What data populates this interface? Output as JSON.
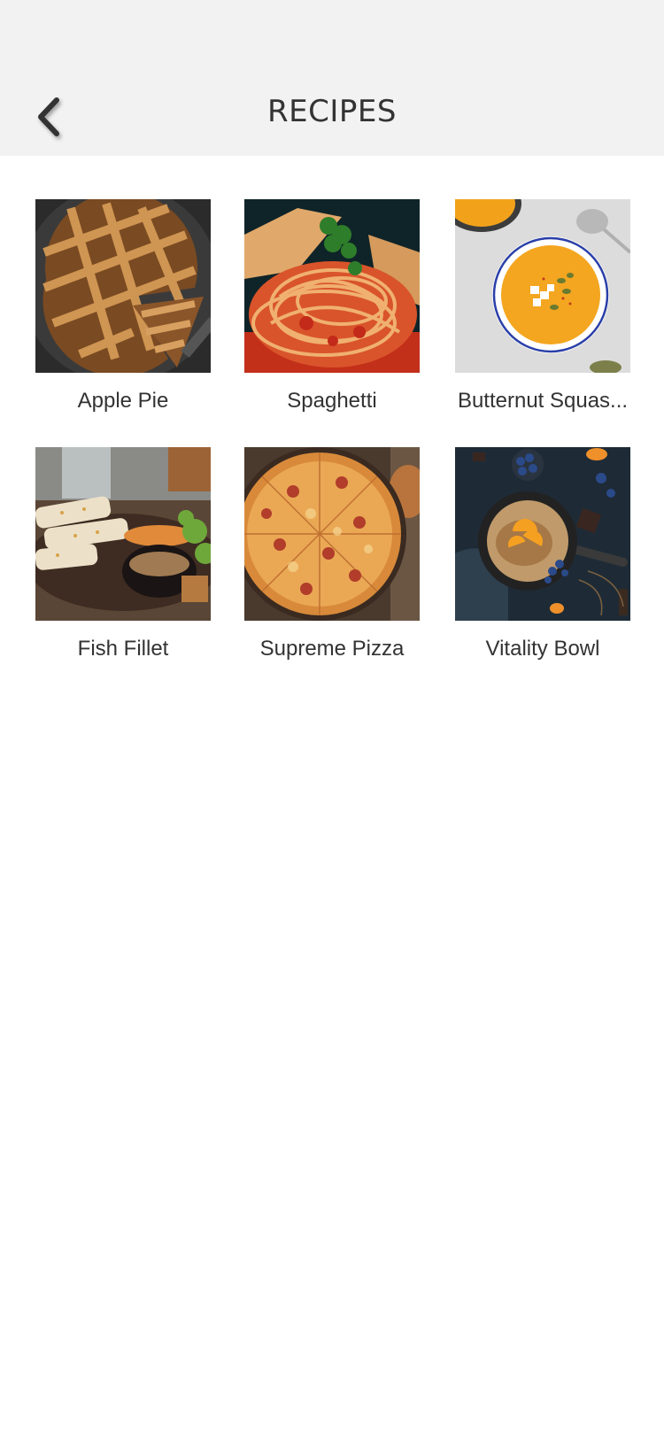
{
  "header": {
    "title": "RECIPES",
    "back_icon": "chevron-left-icon"
  },
  "recipes": [
    {
      "label": "Apple Pie",
      "image": "apple-pie-photo"
    },
    {
      "label": "Spaghetti",
      "image": "spaghetti-photo"
    },
    {
      "label": "Butternut Squas...",
      "image": "butternut-squash-soup-photo"
    },
    {
      "label": "Fish Fillet",
      "image": "fish-fillet-photo"
    },
    {
      "label": "Supreme Pizza",
      "image": "supreme-pizza-photo"
    },
    {
      "label": "Vitality Bowl",
      "image": "vitality-bowl-photo"
    }
  ],
  "colors": {
    "header_bg": "#f2f2f2",
    "text": "#333333",
    "background": "#ffffff"
  }
}
